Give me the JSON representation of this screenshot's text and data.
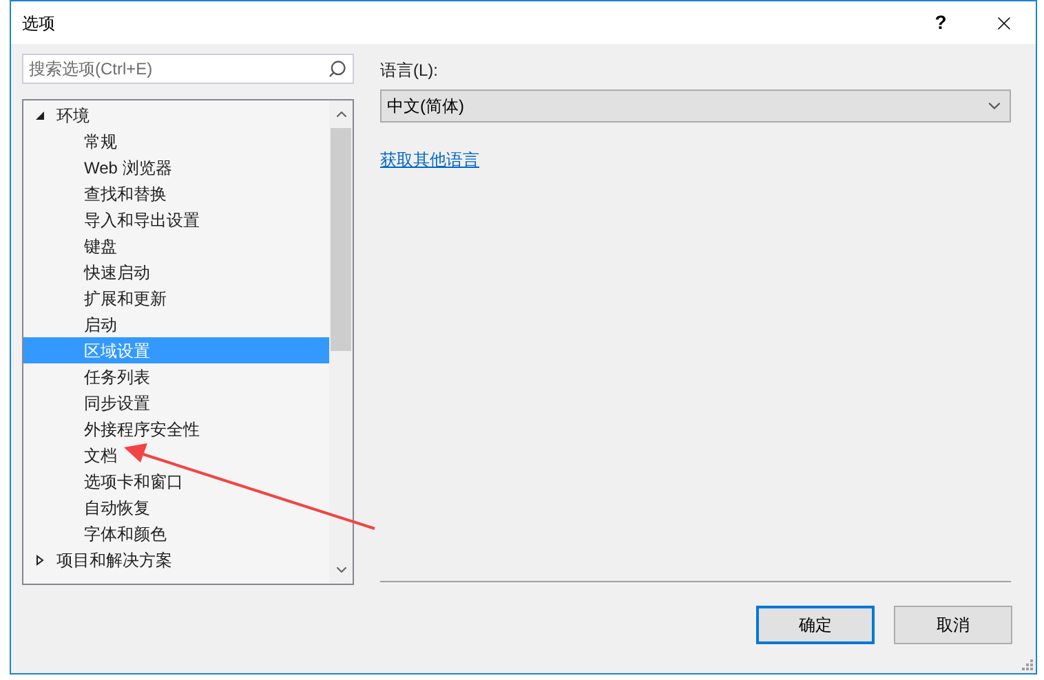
{
  "window": {
    "title": "选项",
    "help": "?"
  },
  "search": {
    "placeholder": "搜索选项(Ctrl+E)"
  },
  "tree": [
    {
      "label": "环境",
      "expanded": true,
      "selected": false,
      "children": [
        {
          "label": "常规",
          "selected": false
        },
        {
          "label": "Web 浏览器",
          "selected": false
        },
        {
          "label": "查找和替换",
          "selected": false
        },
        {
          "label": "导入和导出设置",
          "selected": false
        },
        {
          "label": "键盘",
          "selected": false
        },
        {
          "label": "快速启动",
          "selected": false
        },
        {
          "label": "扩展和更新",
          "selected": false
        },
        {
          "label": "启动",
          "selected": false
        },
        {
          "label": "区域设置",
          "selected": true
        },
        {
          "label": "任务列表",
          "selected": false
        },
        {
          "label": "同步设置",
          "selected": false
        },
        {
          "label": "外接程序安全性",
          "selected": false
        },
        {
          "label": "文档",
          "selected": false
        },
        {
          "label": "选项卡和窗口",
          "selected": false
        },
        {
          "label": "自动恢复",
          "selected": false
        },
        {
          "label": "字体和颜色",
          "selected": false
        }
      ]
    },
    {
      "label": "项目和解决方案",
      "expanded": false,
      "selected": false
    }
  ],
  "language": {
    "label": "语言(L):",
    "value": "中文(简体)"
  },
  "link": "获取其他语言",
  "buttons": [
    {
      "label": "确定",
      "default": true
    },
    {
      "label": "取消",
      "default": false
    }
  ]
}
